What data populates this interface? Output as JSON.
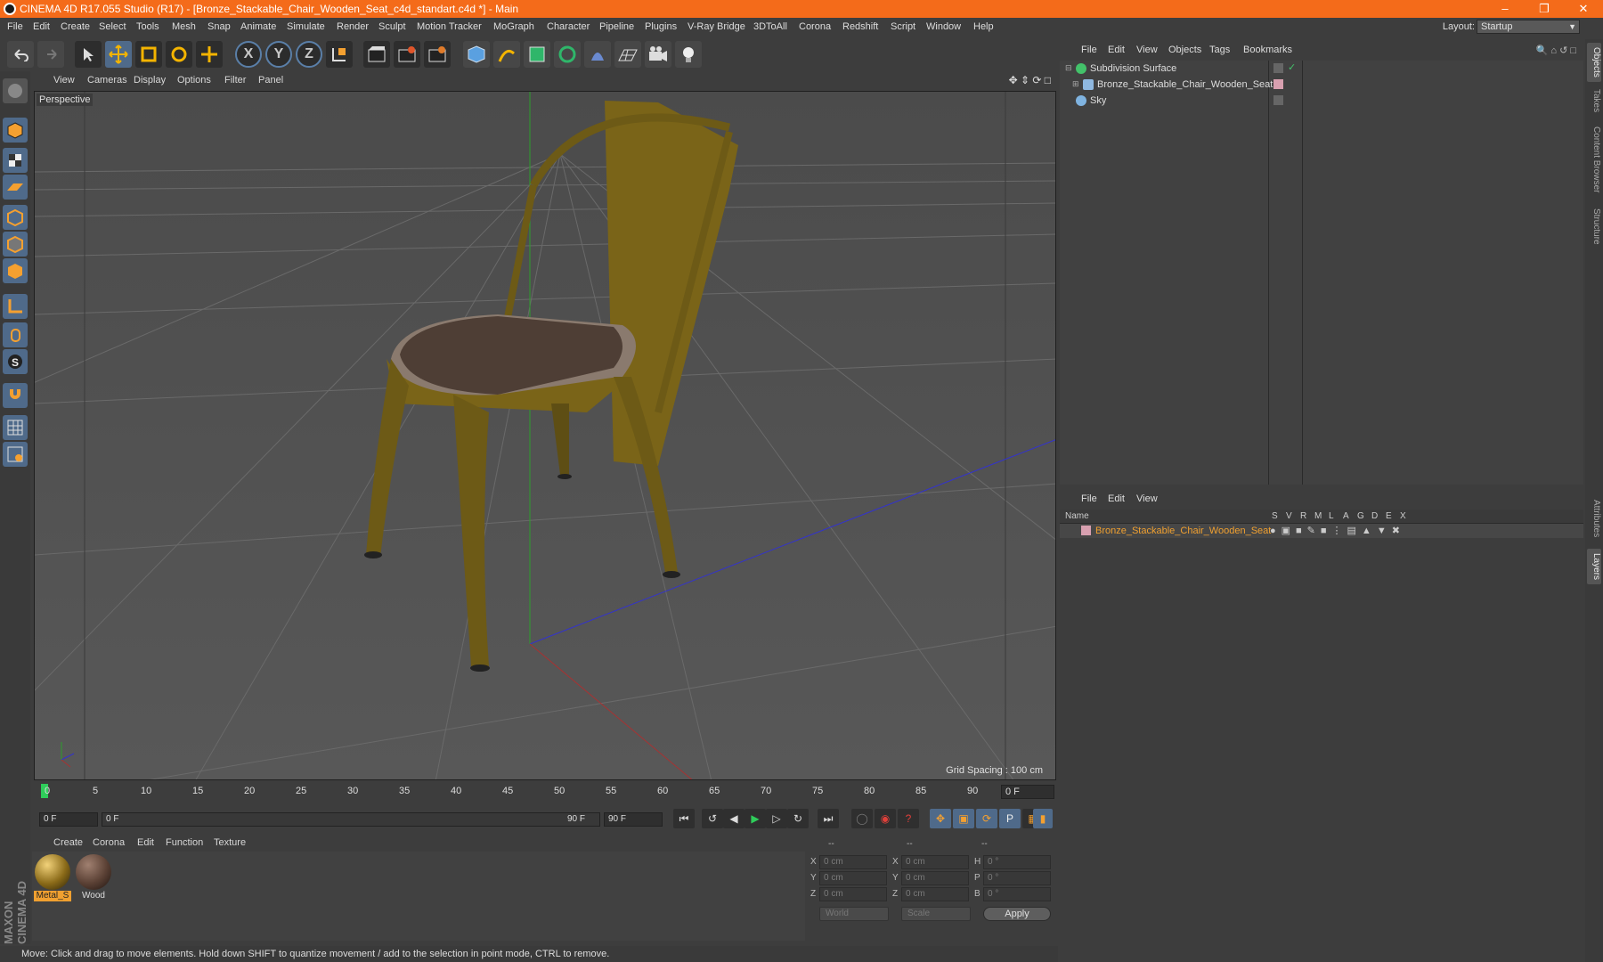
{
  "app": {
    "window_title": "CINEMA 4D R17.055 Studio (R17) - [Bronze_Stackable_Chair_Wooden_Seat_c4d_standart.c4d *] - Main",
    "accent": "#f46b1a"
  },
  "menu": [
    "File",
    "Edit",
    "Create",
    "Select",
    "Tools",
    "Mesh",
    "Snap",
    "Animate",
    "Simulate",
    "Render",
    "Sculpt",
    "Motion Tracker",
    "MoGraph",
    "Character",
    "Pipeline",
    "Plugins",
    "V-Ray Bridge",
    "3DToAll",
    "Corona",
    "Redshift",
    "Script",
    "Window",
    "Help"
  ],
  "layout": {
    "label": "Layout:",
    "value": "Startup"
  },
  "toolbar": {
    "x": "X",
    "y": "Y",
    "z": "Z"
  },
  "viewport": {
    "menu": [
      "View",
      "Cameras",
      "Display",
      "Options",
      "Filter",
      "Panel"
    ],
    "name": "Perspective",
    "grid_spacing": "Grid Spacing : 100 cm"
  },
  "timeline": {
    "ticks": [
      "0",
      "5",
      "10",
      "15",
      "20",
      "25",
      "30",
      "35",
      "40",
      "45",
      "50",
      "55",
      "60",
      "65",
      "70",
      "75",
      "80",
      "85",
      "90"
    ],
    "current_frame": "0 F",
    "start_field": "0 F",
    "range_start": "0 F",
    "range_end": "90 F",
    "end_field": "90 F"
  },
  "materials": {
    "menu": [
      "Create",
      "Corona",
      "Edit",
      "Function",
      "Texture"
    ],
    "items": [
      {
        "label": "Metal_S",
        "selected": true
      },
      {
        "label": "Wood",
        "selected": false
      }
    ]
  },
  "coordinates": {
    "headers": [
      "--",
      "--",
      "--"
    ],
    "pos": [
      {
        "axis": "X",
        "val": "0 cm"
      },
      {
        "axis": "Y",
        "val": "0 cm"
      },
      {
        "axis": "Z",
        "val": "0 cm"
      }
    ],
    "size": [
      {
        "axis": "X",
        "val": "0 cm"
      },
      {
        "axis": "Y",
        "val": "0 cm"
      },
      {
        "axis": "Z",
        "val": "0 cm"
      }
    ],
    "rot": [
      {
        "axis": "H",
        "val": "0 °"
      },
      {
        "axis": "P",
        "val": "0 °"
      },
      {
        "axis": "B",
        "val": "0 °"
      }
    ],
    "world": "World",
    "scale": "Scale",
    "apply": "Apply"
  },
  "status": "Move: Click and drag to move elements. Hold down SHIFT to quantize movement / add to the selection in point mode, CTRL to remove.",
  "objects_panel": {
    "menu": [
      "File",
      "Edit",
      "View",
      "Objects",
      "Tags",
      "Bookmarks"
    ],
    "items": [
      {
        "name": "Subdivision Surface",
        "color": "#43c26a"
      },
      {
        "name": "Bronze_Stackable_Chair_Wooden_Seat",
        "color": "#8fb8e0"
      },
      {
        "name": "Sky",
        "color": "#7fb3e0"
      }
    ]
  },
  "layers_panel": {
    "menu": [
      "File",
      "Edit",
      "View"
    ],
    "columns": [
      "Name",
      "S",
      "V",
      "R",
      "M",
      "L",
      "A",
      "G",
      "D",
      "E",
      "X"
    ],
    "row": "Bronze_Stackable_Chair_Wooden_Seat",
    "row_color": "#f0a030"
  },
  "side_tabs": [
    "Objects",
    "Takes",
    "Content Browser",
    "Structure",
    "Attributes",
    "Layers"
  ]
}
